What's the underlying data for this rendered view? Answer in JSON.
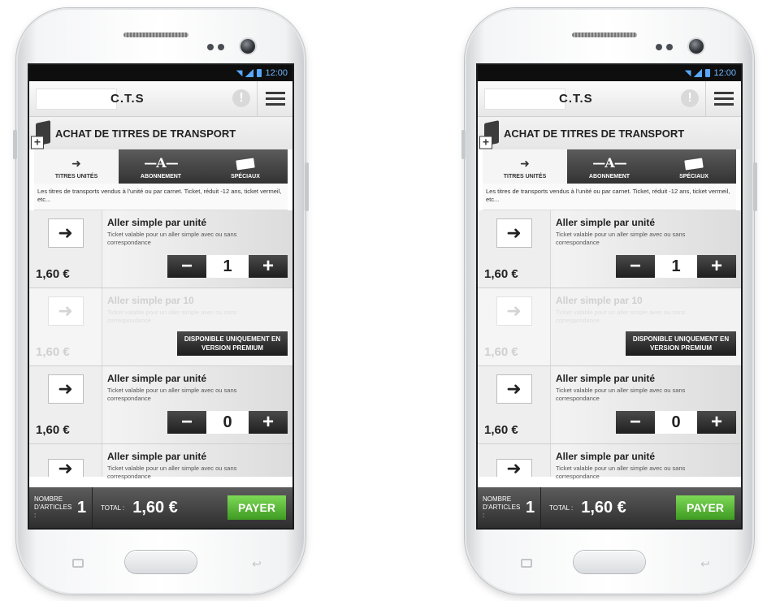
{
  "screens": [
    {
      "status": {
        "time": "12:00"
      },
      "app": {
        "title": "C.T.S",
        "info_glyph": "!"
      },
      "section": {
        "title": "ACHAT DE TITRES DE TRANSPORT"
      },
      "tabs": [
        {
          "label": "TITRES UNITÉS",
          "icon": "arrow-icon",
          "active": true
        },
        {
          "label": "ABONNEMENT",
          "icon": "abonnement-icon",
          "active": false
        },
        {
          "label": "SPÉCIAUX",
          "icon": "card-icon",
          "active": false
        }
      ],
      "description": "Les titres de transports vendus à l'unité ou par carnet. Ticket, réduit -12 ans, ticket vermeil, etc...",
      "items": [
        {
          "name": "Aller simple par unité",
          "detail": "Ticket valable pour un aller simple avec ou sans correspondance",
          "price": "1,60 €",
          "qty": "1"
        },
        {
          "name": "Aller simple par 10",
          "detail": "Ticket valable pour un aller simple avec ou sans correspondance",
          "price": "1,60 €",
          "premium": "DISPONIBLE UNIQUEMENT EN VERSION PREMIUM"
        },
        {
          "name": "Aller simple par unité",
          "detail": "Ticket valable pour un aller simple avec ou sans correspondance",
          "price": "1,60 €",
          "qty": "0"
        },
        {
          "name": "Aller simple par unité",
          "detail": "Ticket valable pour un aller simple avec ou sans correspondance"
        }
      ],
      "footer": {
        "count_label": "NOMBRE D'ARTICLES :",
        "count": "1",
        "total_label": "TOTAL :",
        "total": "1,60 €",
        "pay_label": "PAYER"
      }
    },
    {
      "status": {
        "time": "12:00"
      },
      "app": {
        "title": "C.T.S",
        "info_glyph": "!"
      },
      "section": {
        "title": "ACHAT DE TITRES DE TRANSPORT"
      },
      "tabs": [
        {
          "label": "TITRES UNITÉS",
          "icon": "arrow-icon",
          "active": true
        },
        {
          "label": "ABONNEMENT",
          "icon": "abonnement-icon",
          "active": false
        },
        {
          "label": "SPÉCIAUX",
          "icon": "card-icon",
          "active": false
        }
      ],
      "description": "Les titres de transports vendus à l'unité ou par carnet. Ticket, réduit -12 ans, ticket vermeil, etc...",
      "items": [
        {
          "name": "Aller simple par unité",
          "detail": "Ticket valable pour un aller simple avec ou sans correspondance",
          "price": "1,60 €",
          "qty": "1"
        },
        {
          "name": "Aller simple par 10",
          "detail": "Ticket valable pour un aller simple avec ou sans correspondance",
          "price": "1,60 €",
          "premium": "DISPONIBLE UNIQUEMENT EN VERSION PREMIUM"
        },
        {
          "name": "Aller simple par unité",
          "detail": "Ticket valable pour un aller simple avec ou sans correspondance",
          "price": "1,60 €",
          "qty": "0"
        },
        {
          "name": "Aller simple par unité",
          "detail": "Ticket valable pour un aller simple avec ou sans correspondance"
        }
      ],
      "footer": {
        "count_label": "NOMBRE D'ARTICLES :",
        "count": "1",
        "total_label": "TOTAL :",
        "total": "1,60 €",
        "pay_label": "PAYER"
      }
    }
  ],
  "icons": {
    "minus": "−",
    "plus": "+",
    "arrow": "➜"
  },
  "colors": {
    "pay_green": "#5cb838",
    "status_blue": "#58a8ff",
    "dark_bar": "#333333"
  }
}
